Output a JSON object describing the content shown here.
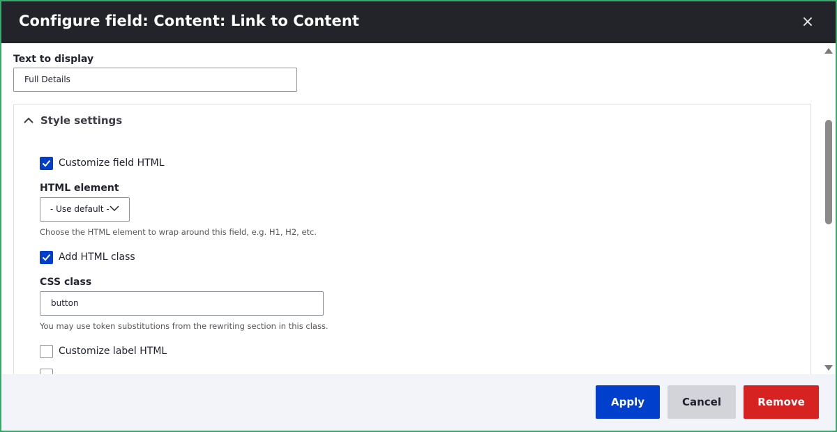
{
  "dialog": {
    "title": "Configure field: Content: Link to Content",
    "close_glyph": "×"
  },
  "form": {
    "text_to_display": {
      "label": "Text to display",
      "value": "Full Details"
    },
    "style_settings": {
      "summary": "Style settings",
      "customize_field_html": {
        "label": "Customize field HTML",
        "checked": true
      },
      "html_element": {
        "label": "HTML element",
        "selected": "- Use default -",
        "description": "Choose the HTML element to wrap around this field, e.g. H1, H2, etc."
      },
      "add_html_class": {
        "label": "Add HTML class",
        "checked": true
      },
      "css_class": {
        "label": "CSS class",
        "value": "button",
        "description": "You may use token substitutions from the rewriting section in this class."
      },
      "customize_label_html": {
        "label": "Customize label HTML",
        "checked": false
      }
    }
  },
  "footer": {
    "apply_label": "Apply",
    "cancel_label": "Cancel",
    "remove_label": "Remove"
  },
  "colors": {
    "primary": "#003ecc",
    "danger": "#d72222",
    "titlebar": "#232429",
    "outer_border": "#3aa86b"
  }
}
